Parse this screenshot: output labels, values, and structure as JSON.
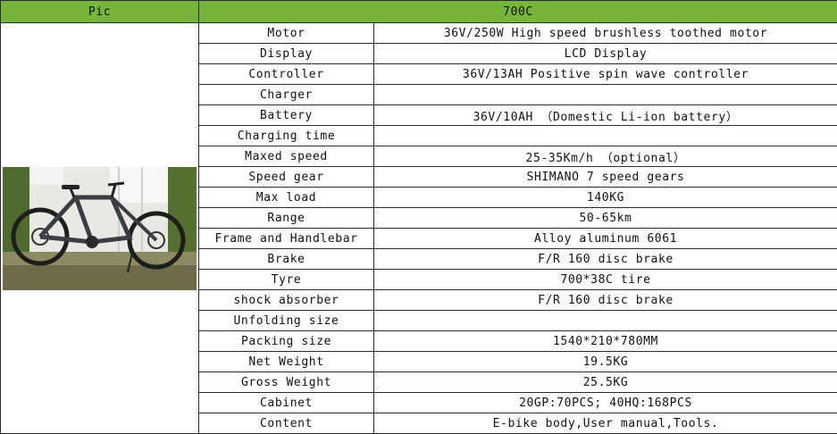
{
  "header": {
    "pic": "Pic",
    "model": "700C"
  },
  "rows": [
    {
      "label": "Motor",
      "value": "36V/250W High speed brushless toothed motor"
    },
    {
      "label": "Display",
      "value": "LCD Display"
    },
    {
      "label": "Controller",
      "value": "36V/13AH Positive spin wave controller"
    },
    {
      "label": "Charger",
      "value": ""
    },
    {
      "label": "Battery",
      "value": "36V/10AH  （Domestic Li-ion battery）"
    },
    {
      "label": "Charging time",
      "value": ""
    },
    {
      "label": "Maxed speed",
      "value": "25-35Km/h  （optional）"
    },
    {
      "label": "Speed gear",
      "value": "SHIMANO 7 speed gears"
    },
    {
      "label": "Max load",
      "value": "140KG"
    },
    {
      "label": "Range",
      "value": "50-65km"
    },
    {
      "label": "Frame and Handlebar",
      "value": "Alloy aluminum 6061"
    },
    {
      "label": "Brake",
      "value": "F/R 160  disc brake"
    },
    {
      "label": "Tyre",
      "value": "700*38C tire"
    },
    {
      "label": "shock absorber",
      "value": "F/R 160  disc brake"
    },
    {
      "label": "Unfolding size",
      "value": ""
    },
    {
      "label": "Packing size",
      "value": "1540*210*780MM"
    },
    {
      "label": "Net Weight",
      "value": "19.5KG"
    },
    {
      "label": "Gross Weight",
      "value": "25.5KG"
    },
    {
      "label": "Cabinet",
      "value": "20GP:70PCS;      40HQ:168PCS"
    },
    {
      "label": "Content",
      "value": "E-bike body,User manual,Tools."
    }
  ],
  "colors": {
    "header_bg": "#76b43a",
    "border": "#2b2b2b"
  },
  "photo": {
    "icon": "e-bike-photo"
  }
}
